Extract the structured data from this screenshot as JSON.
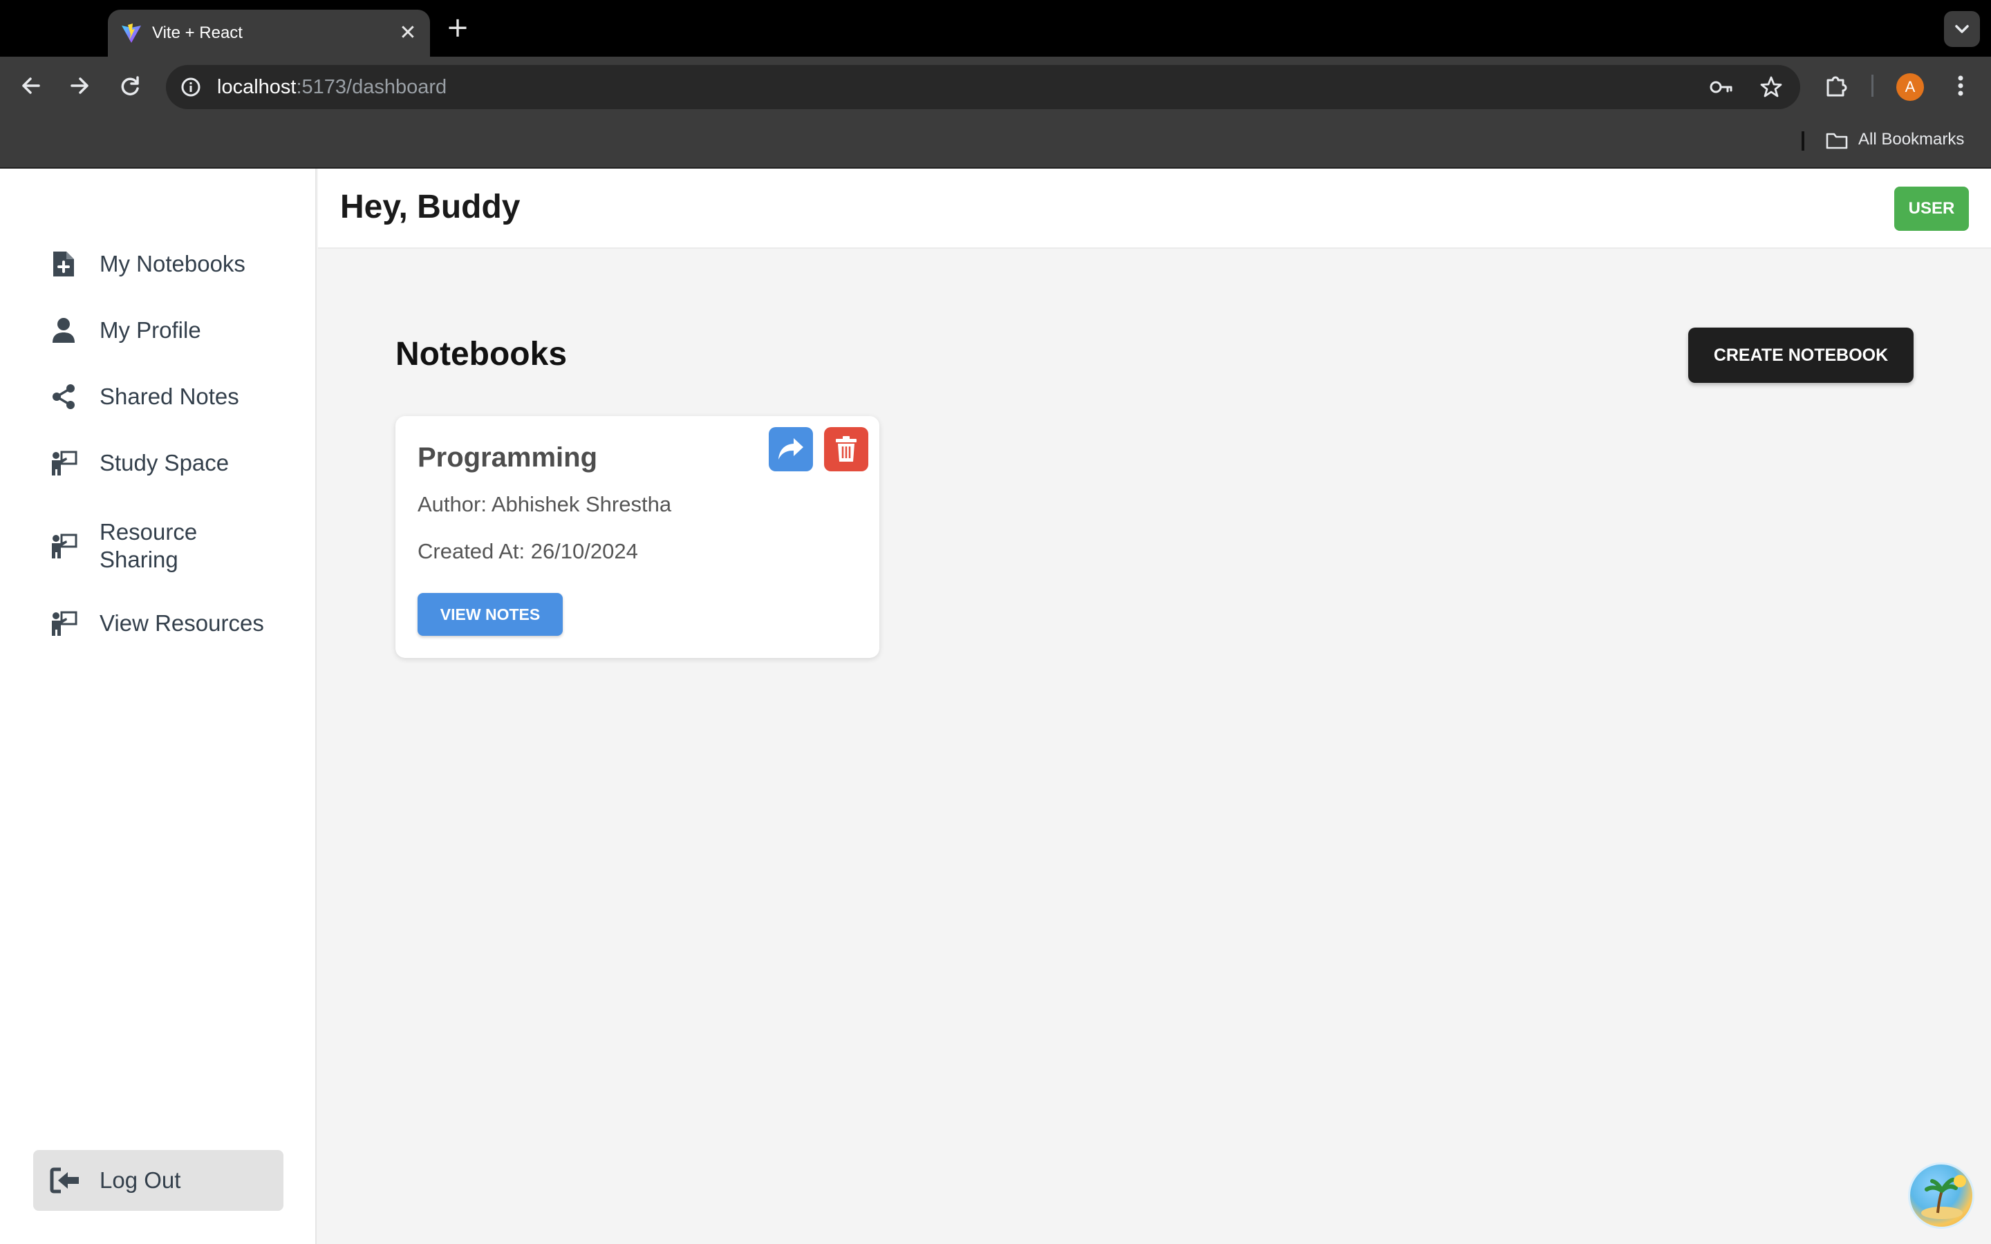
{
  "browser": {
    "tab_title": "Vite + React",
    "url_host": "localhost",
    "url_path": ":5173/dashboard",
    "profile_initial": "A",
    "bookmarks_label": "All Bookmarks"
  },
  "sidebar": {
    "items": [
      {
        "label": "My Notebooks",
        "icon": "file-plus-icon"
      },
      {
        "label": "My Profile",
        "icon": "user-icon"
      },
      {
        "label": "Shared Notes",
        "icon": "share-nodes-icon"
      },
      {
        "label": "Study Space",
        "icon": "teacher-icon"
      },
      {
        "label": "Resource Sharing",
        "icon": "teacher-icon"
      },
      {
        "label": "View Resources",
        "icon": "teacher-icon"
      }
    ],
    "logout_label": "Log Out"
  },
  "header": {
    "greeting": "Hey, Buddy",
    "role_badge": "USER"
  },
  "main": {
    "section_title": "Notebooks",
    "create_button": "CREATE NOTEBOOK",
    "notebooks": [
      {
        "title": "Programming",
        "author": "Author: Abhishek Shrestha",
        "created": "Created At: 26/10/2024",
        "view_button": "VIEW NOTES"
      }
    ]
  },
  "colors": {
    "badge_green": "#4caf50",
    "primary_blue": "#4a90e2",
    "danger_red": "#e34c3c",
    "dark_button": "#1f1f1f"
  }
}
